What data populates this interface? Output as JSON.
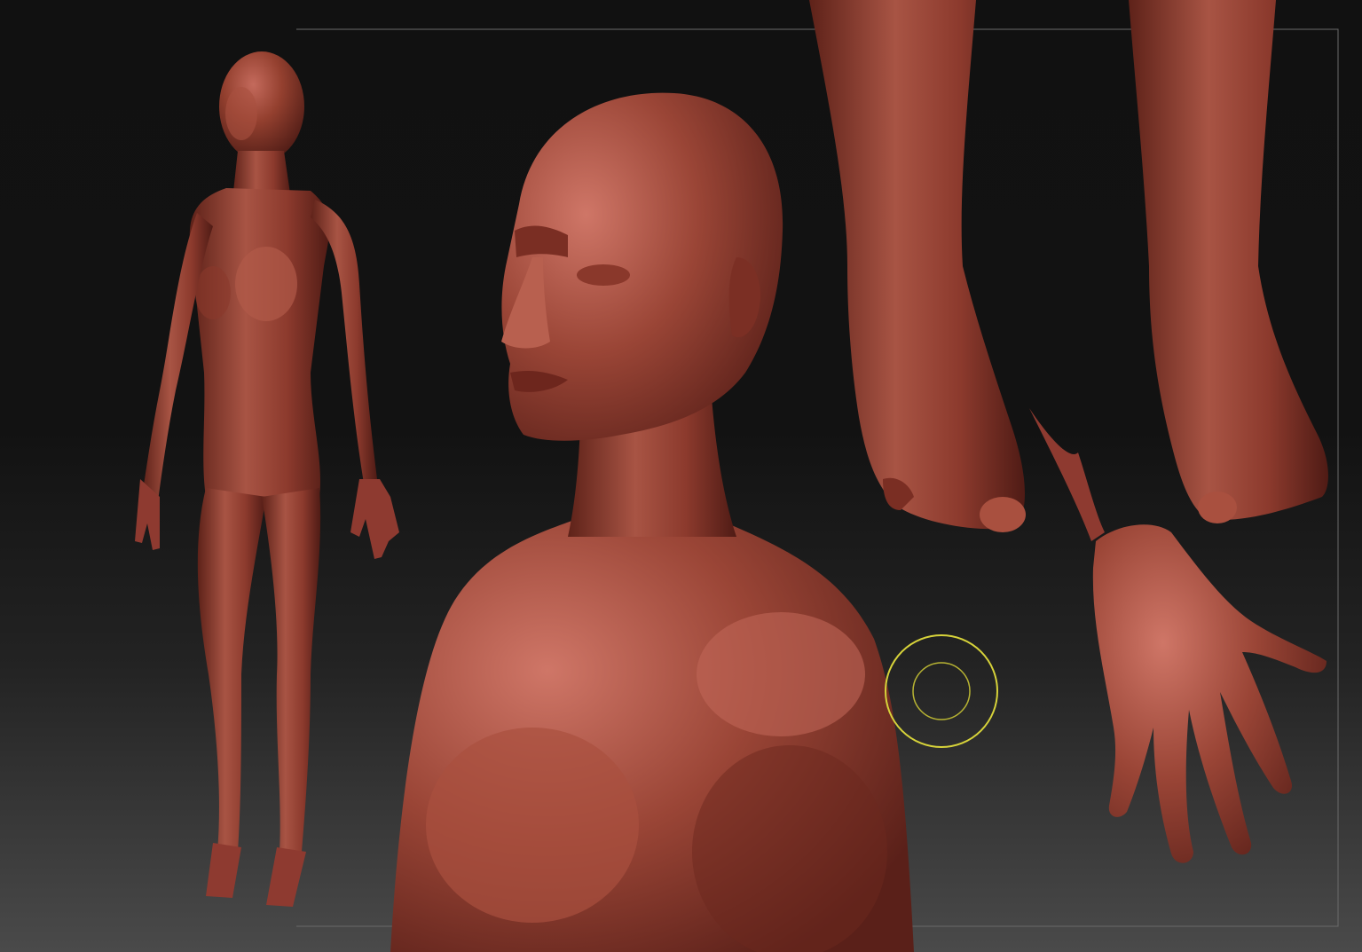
{
  "canvas": {
    "background_top": "#111111",
    "background_bottom": "#4a4a4a",
    "frame_color": "#6a6a6a"
  },
  "material": {
    "base": "#8e3a30",
    "highlight": "#c96b5d",
    "shadow": "#4a1a14"
  },
  "brush_cursor": {
    "outer_color": "#d7d33a",
    "inner_color": "#b8b433"
  },
  "views": [
    {
      "name": "full-body"
    },
    {
      "name": "head-torso-closeup"
    },
    {
      "name": "feet-closeup"
    },
    {
      "name": "hand-closeup"
    }
  ]
}
